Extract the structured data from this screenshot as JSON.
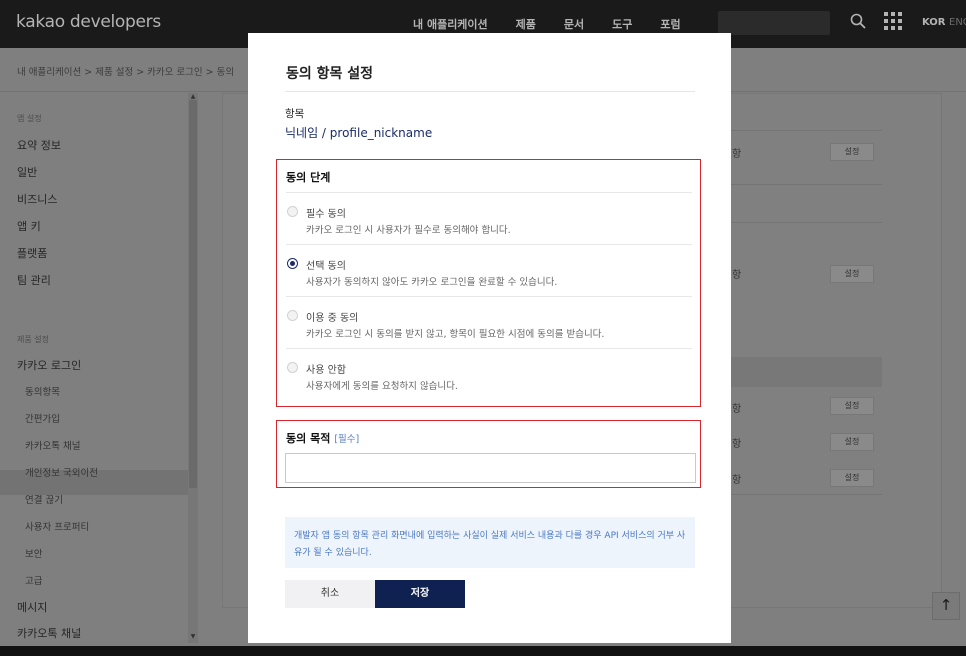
{
  "header": {
    "brand": "kakao developers",
    "menu": [
      "내 애플리케이션",
      "제품",
      "문서",
      "도구",
      "포럼"
    ],
    "lang_active": "KOR",
    "lang_other": "ENG"
  },
  "breadcrumb": "내 애플리케이션 > 제품 설정 > 카카오 로그인 > 동의",
  "sidebar": {
    "group1": "앱 설정",
    "items1": [
      "요약 정보",
      "일반",
      "비즈니스",
      "앱 키",
      "플랫폼",
      "팀 관리"
    ],
    "group2": "제품 설정",
    "kakao_login": "카카오 로그인",
    "sub_items": [
      "동의항목",
      "간편가입",
      "카카오톡 채널",
      "개인정보 국외이전",
      "연결 끊기",
      "사용자 프로퍼티",
      "보안",
      "고급"
    ],
    "items2": [
      "메시지",
      "카카오톡 채널"
    ]
  },
  "background": {
    "row_text": "항",
    "set_label": "설정"
  },
  "modal": {
    "title": "동의 항목 설정",
    "field_label": "항목",
    "field_value": "닉네임 / profile_nickname",
    "stage": {
      "title": "동의 단계",
      "options": [
        {
          "title": "필수 동의",
          "desc": "카카오 로그인 시 사용자가 필수로 동의해야 합니다.",
          "checked": false
        },
        {
          "title": "선택 동의",
          "desc": "사용자가 동의하지 않아도 카카오 로그인을 완료할 수 있습니다.",
          "checked": true
        },
        {
          "title": "이용 중 동의",
          "desc": "카카오 로그인 시 동의를 받지 않고, 항목이 필요한 시점에 동의를 받습니다.",
          "checked": false
        },
        {
          "title": "사용 안함",
          "desc": "사용자에게 동의를 요청하지 않습니다.",
          "checked": false
        }
      ]
    },
    "purpose": {
      "title": "동의 목적",
      "required": "[필수]",
      "value": ""
    },
    "notice": "개발자 앱 동의 항목 관리 화면내에 입력하는 사실이 실제 서비스 내용과 다를 경우 API 서비스의 거부 사유가 될 수 있습니다.",
    "cancel_label": "취소",
    "save_label": "저장"
  },
  "scroll_top": "↑",
  "colors": {
    "accent_navy": "#0f2150",
    "highlight_red": "#d7262e",
    "notice_blue": "#4b79c6"
  }
}
